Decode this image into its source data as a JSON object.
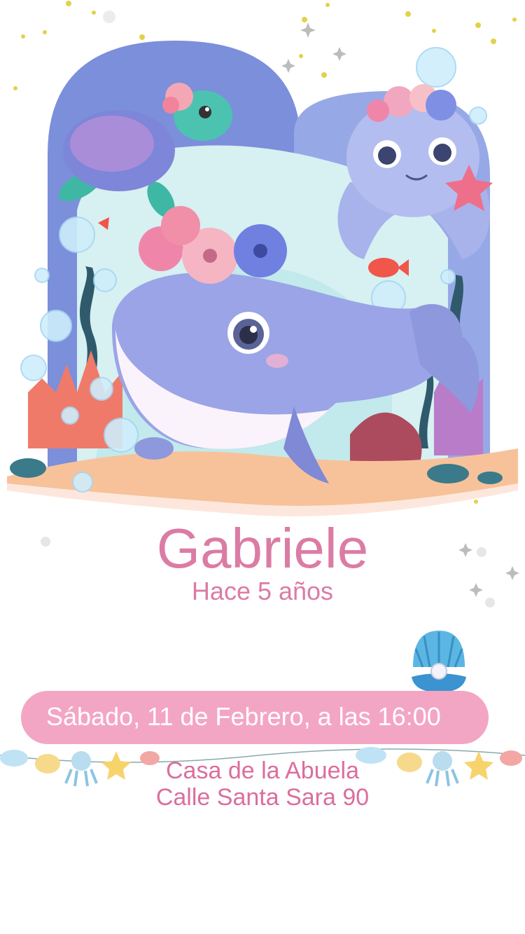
{
  "invitation": {
    "name": "Gabriele",
    "age_line": "Hace 5 años",
    "date_line": "Sábado, 11 de Febrero, a las 16:00",
    "venue": "Casa de la Abuela",
    "address": "Calle Santa Sara 90"
  },
  "colors": {
    "text_pink": "#db7ca5",
    "pill_pink": "#f3a6c3",
    "arch_blue": "#7b8fdb",
    "whale_lilac": "#9aa4e6"
  },
  "illustration": {
    "subjects": [
      "whale",
      "turtle",
      "octopus",
      "starfish",
      "fish",
      "coral",
      "pearl-shell",
      "sea-garland"
    ]
  }
}
